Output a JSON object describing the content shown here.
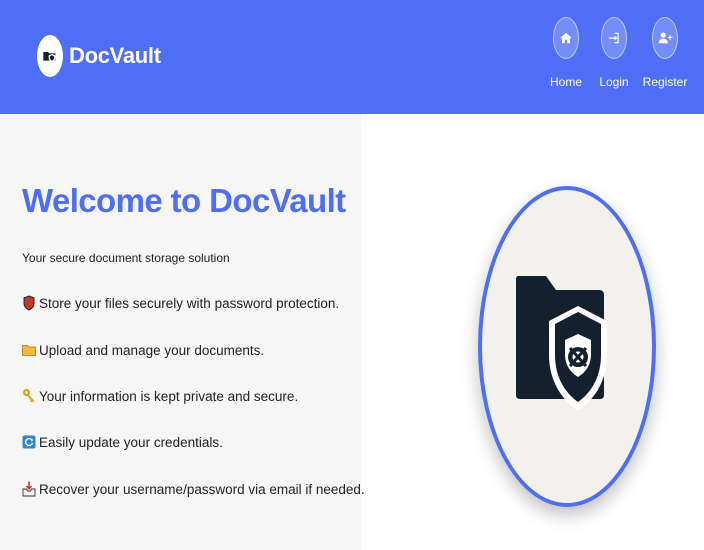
{
  "header": {
    "brand": {
      "name": "DocVault",
      "logo_icon": "folder-shield-icon"
    },
    "nav": [
      {
        "label": "Home",
        "icon": "home-icon"
      },
      {
        "label": "Login",
        "icon": "login-icon"
      },
      {
        "label": "Register",
        "icon": "user-plus-icon"
      }
    ]
  },
  "hero": {
    "title": "Welcome to DocVault",
    "subtitle": "Your secure document storage solution",
    "features": [
      {
        "icon": "shield-icon",
        "text": "Store your files securely with password protection."
      },
      {
        "icon": "folder-icon",
        "text": "Upload and manage your documents."
      },
      {
        "icon": "key-icon",
        "text": "Your information is kept private and secure."
      },
      {
        "icon": "refresh-icon",
        "text": "Easily update your credentials."
      },
      {
        "icon": "inbox-icon",
        "text": "Recover your username/password via email if needed."
      }
    ],
    "illustration_icon": "folder-shield-icon"
  },
  "colors": {
    "accent": "#4d6ef5",
    "left_panel_bg": "#f6f6f7",
    "illustration_bg": "#f2f1ed",
    "illustration_fg": "#14202e"
  }
}
